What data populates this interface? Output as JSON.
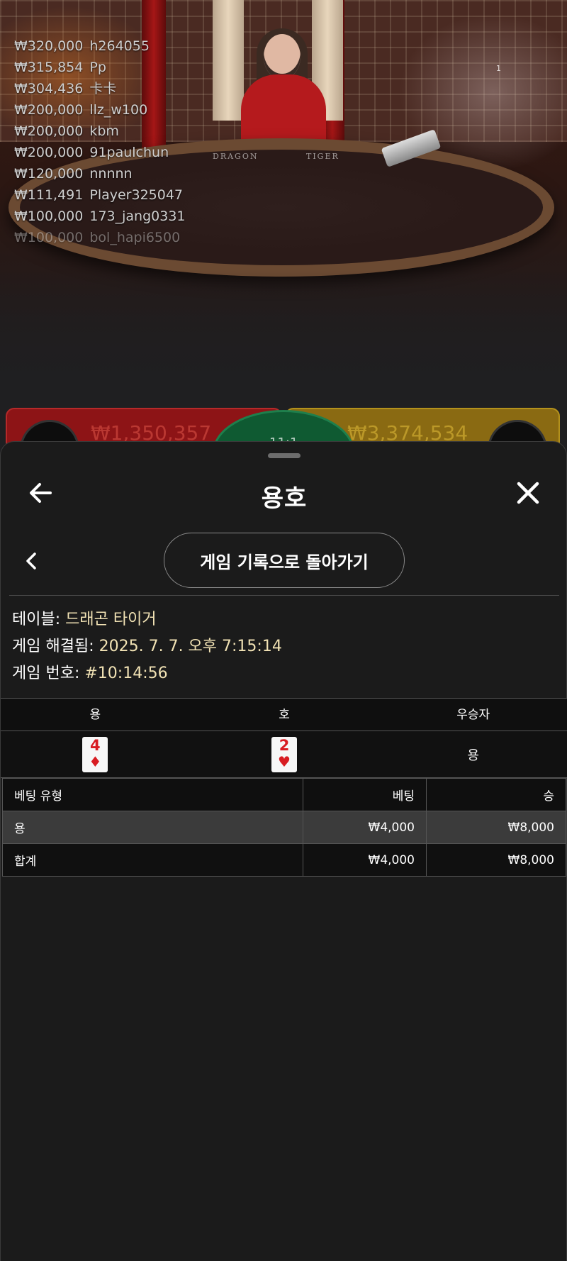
{
  "stage": {
    "table_left_label": "DRAGON",
    "table_right_label": "TIGER",
    "corner_count": "1",
    "winners": [
      {
        "amount": "₩320,000",
        "name": "h264055"
      },
      {
        "amount": "₩315,854",
        "name": "Pp"
      },
      {
        "amount": "₩304,436",
        "name": "卡卡"
      },
      {
        "amount": "₩200,000",
        "name": "llz_w100"
      },
      {
        "amount": "₩200,000",
        "name": "kbm"
      },
      {
        "amount": "₩200,000",
        "name": "91paulchun"
      },
      {
        "amount": "₩120,000",
        "name": "nnnnn"
      },
      {
        "amount": "₩111,491",
        "name": "Player325047"
      },
      {
        "amount": "₩100,000",
        "name": "173_jang0331"
      },
      {
        "amount": "₩100,000",
        "name": "bol_hapi6500"
      }
    ],
    "dragon_total": "₩1,350,357",
    "tiger_total": "₩3,374,534",
    "tie_text": "11:1"
  },
  "sheet": {
    "title": "용호",
    "history_button_label": "게임 기록으로 돌아가기",
    "table_label": "테이블:",
    "table_value": "드래곤 타이거",
    "resolved_label": "게임 해결됨:",
    "resolved_value": "2025. 7. 7. 오후 7:15:14",
    "number_label": "게임 번호:",
    "number_value": "#10:14:56"
  },
  "cards_table": {
    "headers": {
      "dragon": "용",
      "tiger": "호",
      "winner": "우승자"
    },
    "dragon_card": {
      "rank": "4",
      "suit": "♦"
    },
    "tiger_card": {
      "rank": "2",
      "suit": "♥"
    },
    "winner": "용"
  },
  "bets_table": {
    "headers": {
      "type": "베팅 유형",
      "bet": "베팅",
      "win": "승"
    },
    "rows": [
      {
        "type": "용",
        "bet": "₩4,000",
        "win": "₩8,000"
      }
    ],
    "total": {
      "type": "합계",
      "bet": "₩4,000",
      "win": "₩8,000"
    }
  },
  "colors": {
    "accent_value": "#f1e2b4",
    "card_red": "#d81c22",
    "dragon_red": "#8d1416",
    "tiger_gold": "#8a6a12"
  }
}
